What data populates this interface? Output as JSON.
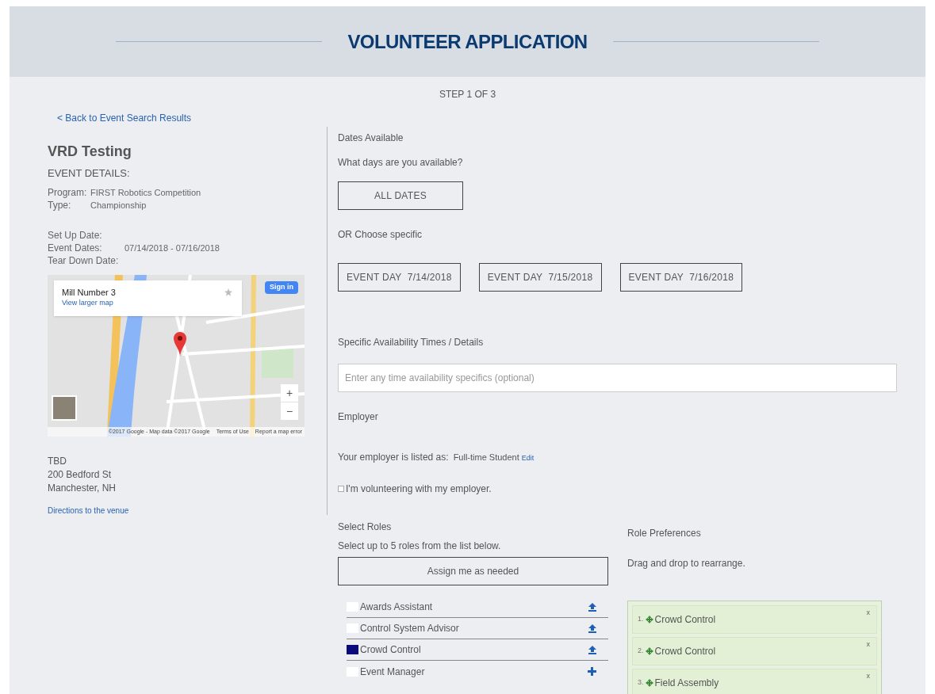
{
  "header": {
    "title": "VOLUNTEER APPLICATION",
    "step": "STEP 1 OF 3"
  },
  "back_link": "< Back to Event Search Results",
  "event": {
    "name": "VRD Testing",
    "details_heading": "EVENT DETAILS:",
    "field_groups": [
      [
        {
          "label": "Program:",
          "value": "FIRST Robotics Competition"
        },
        {
          "label": "Type:",
          "value": "Championship"
        }
      ],
      [
        {
          "label": "Set Up Date:"
        },
        {
          "label": "Event Dates:",
          "value": "07/14/2018 - 07/16/2018"
        },
        {
          "label": "Tear Down Date:"
        }
      ]
    ]
  },
  "map": {
    "place_name": "Mill Number 3",
    "larger_map_link": "View larger map",
    "sign_in": "Sign in",
    "zoom_in": "+",
    "zoom_out": "−",
    "attribution": [
      "©2017 Google - Map data ©2017 Google",
      "Terms of Use",
      "Report a map error"
    ]
  },
  "venue": {
    "lines": [
      "TBD",
      "200 Bedford St",
      "Manchester, NH"
    ],
    "directions_link": "Directions to the venue"
  },
  "dates": {
    "heading": "Dates Available",
    "question": "What days are you available?",
    "all_dates": {
      "label": "ALL DATES",
      "selected": false
    },
    "or_choose": "OR Choose specific",
    "days": [
      {
        "label": "EVENT DAY  7/14/2018",
        "selected": false
      },
      {
        "label": "EVENT DAY  7/15/2018",
        "selected": false
      },
      {
        "label": "EVENT DAY  7/16/2018",
        "selected": false
      }
    ]
  },
  "availability": {
    "label": "Specific Availability Times / Details",
    "placeholder": "Enter any time availability specifics (optional)"
  },
  "employer": {
    "heading": "Employer",
    "listed_as": "Your employer is listed as:",
    "value": "Full-time Student",
    "edit_link": "Edit",
    "with_employer": {
      "label": "I'm volunteering with my employer.",
      "checked": false
    }
  },
  "roles": {
    "heading": "Select Roles",
    "hint": "Select up to 5 roles from the list below.",
    "assign_button": "Assign me as needed",
    "items": [
      {
        "label": "Awards Assistant",
        "checked": false,
        "kind": "promote"
      },
      {
        "label": "Control System Advisor",
        "checked": false,
        "kind": "promote"
      },
      {
        "label": "Crowd Control",
        "checked": true,
        "kind": "promote"
      },
      {
        "label": "Event Manager",
        "checked": false,
        "kind": "add"
      }
    ]
  },
  "preferences": {
    "heading": "Role Preferences",
    "hint": "Drag and drop to rearrange.",
    "items": [
      {
        "number": "1.",
        "label": "Crowd Control",
        "remove": "x"
      },
      {
        "number": "2.",
        "label": "Crowd Control",
        "remove": "x"
      },
      {
        "number": "3.",
        "label": "Field Assembly",
        "remove": "x"
      }
    ]
  }
}
